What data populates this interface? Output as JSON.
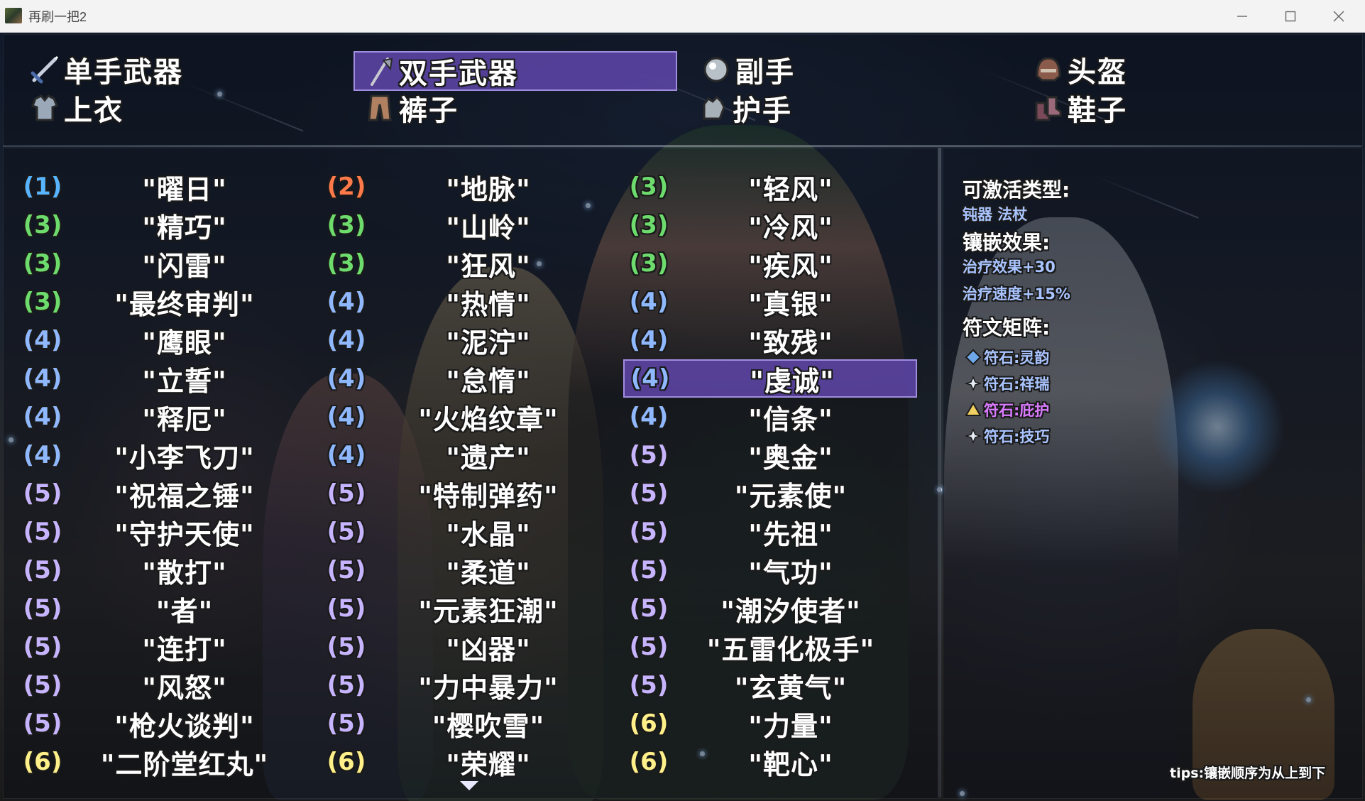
{
  "window": {
    "title": "再刷一把2"
  },
  "colors": {
    "level_1": "#58b4ff",
    "level_2": "#ff7a4a",
    "level_3": "#6ddc6d",
    "level_4": "#8fb8ff",
    "level_5": "#c7b4ff",
    "level_6": "#fff08a",
    "selection": "#5f46aa",
    "heading": "#ffffff",
    "detail": "#a9c4ff",
    "rune_selected": "#d97bff"
  },
  "tabs": [
    {
      "label": "单手武器",
      "icon": "sword-icon",
      "selected": false
    },
    {
      "label": "双手武器",
      "icon": "axe-icon",
      "selected": true
    },
    {
      "label": "副手",
      "icon": "orb-icon",
      "selected": false
    },
    {
      "label": "头盔",
      "icon": "helmet-icon",
      "selected": false
    },
    {
      "label": "上衣",
      "icon": "armor-icon",
      "selected": false
    },
    {
      "label": "裤子",
      "icon": "pants-icon",
      "selected": false
    },
    {
      "label": "护手",
      "icon": "gauntlet-icon",
      "selected": false
    },
    {
      "label": "鞋子",
      "icon": "boots-icon",
      "selected": false
    }
  ],
  "columns": [
    {
      "items": [
        {
          "level": "(1)",
          "tier": 1,
          "name": "\"曜日\""
        },
        {
          "level": "(3)",
          "tier": 3,
          "name": "\"精巧\""
        },
        {
          "level": "(3)",
          "tier": 3,
          "name": "\"闪雷\""
        },
        {
          "level": "(3)",
          "tier": 3,
          "name": "\"最终审判\""
        },
        {
          "level": "(4)",
          "tier": 4,
          "name": "\"鹰眼\""
        },
        {
          "level": "(4)",
          "tier": 4,
          "name": "\"立誓\""
        },
        {
          "level": "(4)",
          "tier": 4,
          "name": "\"释厄\""
        },
        {
          "level": "(4)",
          "tier": 4,
          "name": "\"小李飞刀\""
        },
        {
          "level": "(5)",
          "tier": 5,
          "name": "\"祝福之锤\""
        },
        {
          "level": "(5)",
          "tier": 5,
          "name": "\"守护天使\""
        },
        {
          "level": "(5)",
          "tier": 5,
          "name": "\"散打\""
        },
        {
          "level": "(5)",
          "tier": 5,
          "name": "\"者\""
        },
        {
          "level": "(5)",
          "tier": 5,
          "name": "\"连打\""
        },
        {
          "level": "(5)",
          "tier": 5,
          "name": "\"风怒\""
        },
        {
          "level": "(5)",
          "tier": 5,
          "name": "\"枪火谈判\""
        },
        {
          "level": "(6)",
          "tier": 6,
          "name": "\"二阶堂红丸\""
        }
      ]
    },
    {
      "items": [
        {
          "level": "(2)",
          "tier": 2,
          "name": "\"地脉\""
        },
        {
          "level": "(3)",
          "tier": 3,
          "name": "\"山岭\""
        },
        {
          "level": "(3)",
          "tier": 3,
          "name": "\"狂风\""
        },
        {
          "level": "(4)",
          "tier": 4,
          "name": "\"热情\""
        },
        {
          "level": "(4)",
          "tier": 4,
          "name": "\"泥泞\""
        },
        {
          "level": "(4)",
          "tier": 4,
          "name": "\"怠惰\""
        },
        {
          "level": "(4)",
          "tier": 4,
          "name": "\"火焰纹章\""
        },
        {
          "level": "(4)",
          "tier": 4,
          "name": "\"遗产\""
        },
        {
          "level": "(5)",
          "tier": 5,
          "name": "\"特制弹药\""
        },
        {
          "level": "(5)",
          "tier": 5,
          "name": "\"水晶\""
        },
        {
          "level": "(5)",
          "tier": 5,
          "name": "\"柔道\""
        },
        {
          "level": "(5)",
          "tier": 5,
          "name": "\"元素狂潮\""
        },
        {
          "level": "(5)",
          "tier": 5,
          "name": "\"凶器\""
        },
        {
          "level": "(5)",
          "tier": 5,
          "name": "\"力中暴力\""
        },
        {
          "level": "(5)",
          "tier": 5,
          "name": "\"樱吹雪\""
        },
        {
          "level": "(6)",
          "tier": 6,
          "name": "\"荣耀\""
        }
      ]
    },
    {
      "items": [
        {
          "level": "(3)",
          "tier": 3,
          "name": "\"轻风\""
        },
        {
          "level": "(3)",
          "tier": 3,
          "name": "\"冷风\""
        },
        {
          "level": "(3)",
          "tier": 3,
          "name": "\"疾风\""
        },
        {
          "level": "(4)",
          "tier": 4,
          "name": "\"真银\""
        },
        {
          "level": "(4)",
          "tier": 4,
          "name": "\"致残\""
        },
        {
          "level": "(4)",
          "tier": 4,
          "name": "\"虔诚\"",
          "selected": true
        },
        {
          "level": "(4)",
          "tier": 4,
          "name": "\"信条\""
        },
        {
          "level": "(5)",
          "tier": 5,
          "name": "\"奥金\""
        },
        {
          "level": "(5)",
          "tier": 5,
          "name": "\"元素使\""
        },
        {
          "level": "(5)",
          "tier": 5,
          "name": "\"先祖\""
        },
        {
          "level": "(5)",
          "tier": 5,
          "name": "\"气功\""
        },
        {
          "level": "(5)",
          "tier": 5,
          "name": "\"潮汐使者\""
        },
        {
          "level": "(5)",
          "tier": 5,
          "name": "\"五雷化极手\""
        },
        {
          "level": "(5)",
          "tier": 5,
          "name": "\"玄黄气\""
        },
        {
          "level": "(6)",
          "tier": 6,
          "name": "\"力量\""
        },
        {
          "level": "(6)",
          "tier": 6,
          "name": "\"靶心\""
        }
      ]
    }
  ],
  "info": {
    "activatable_title": "可激活类型:",
    "activatable_types": "钝器  法杖",
    "effect_title": "镶嵌效果:",
    "effects": [
      "治疗效果+30",
      "治疗速度+15%"
    ],
    "runes_title": "符文矩阵:",
    "runes": [
      {
        "label": "符石:灵韵",
        "icon": "blue-rune-icon",
        "selected": false
      },
      {
        "label": "符石:祥瑞",
        "icon": "white-rune-icon",
        "selected": false
      },
      {
        "label": "符石:庇护",
        "icon": "gold-rune-icon",
        "selected": true
      },
      {
        "label": "符石:技巧",
        "icon": "white-rune-icon",
        "selected": false
      }
    ],
    "tips": "tips:镶嵌顺序为从上到下"
  }
}
